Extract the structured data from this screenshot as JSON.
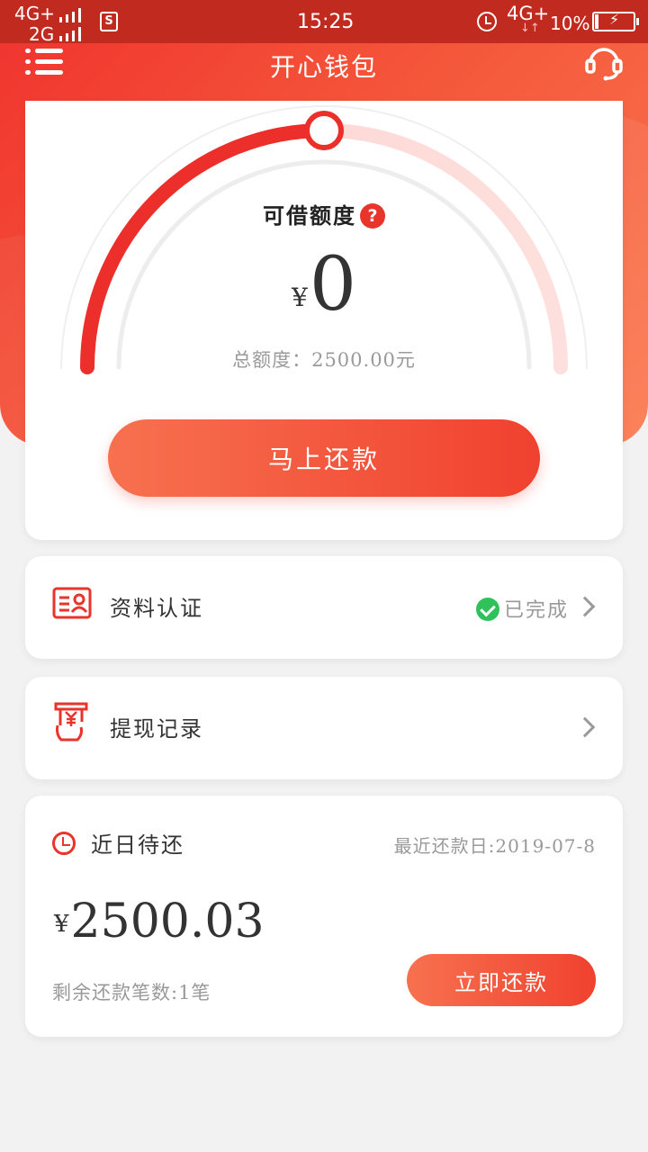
{
  "status_bar": {
    "network_1": "4G+",
    "network_2": "2G",
    "sim_badge": "S",
    "time": "15:25",
    "data_network": "4G+",
    "data_arrows": "↓↑",
    "battery": "10%",
    "icons": [
      "signal-icon",
      "sim-icon",
      "alarm-icon",
      "battery-icon"
    ]
  },
  "header": {
    "title": "开心钱包",
    "menu_icon": "menu-icon",
    "service_icon": "customer-service-icon"
  },
  "credit": {
    "label": "可借额度",
    "help_symbol": "?",
    "currency": "¥",
    "available": "0",
    "total_line": "总额度：2500.00元",
    "usage_fraction": 0.5,
    "button": "马上还款"
  },
  "profile_row": {
    "label": "资料认证",
    "status": "已完成",
    "icon": "id-card-icon"
  },
  "withdraw_row": {
    "label": "提现记录",
    "icon": "cash-withdraw-icon"
  },
  "due": {
    "title": "近日待还",
    "recent_date": "最近还款日:2019-07-8",
    "currency": "¥",
    "amount": "2500.03",
    "remaining": "剩余还款笔数:1笔",
    "button": "立即还款"
  },
  "colors": {
    "primary": "#f0322e",
    "accent_end": "#fb7a50",
    "success": "#2fc25b",
    "background": "#f2f2f2"
  }
}
